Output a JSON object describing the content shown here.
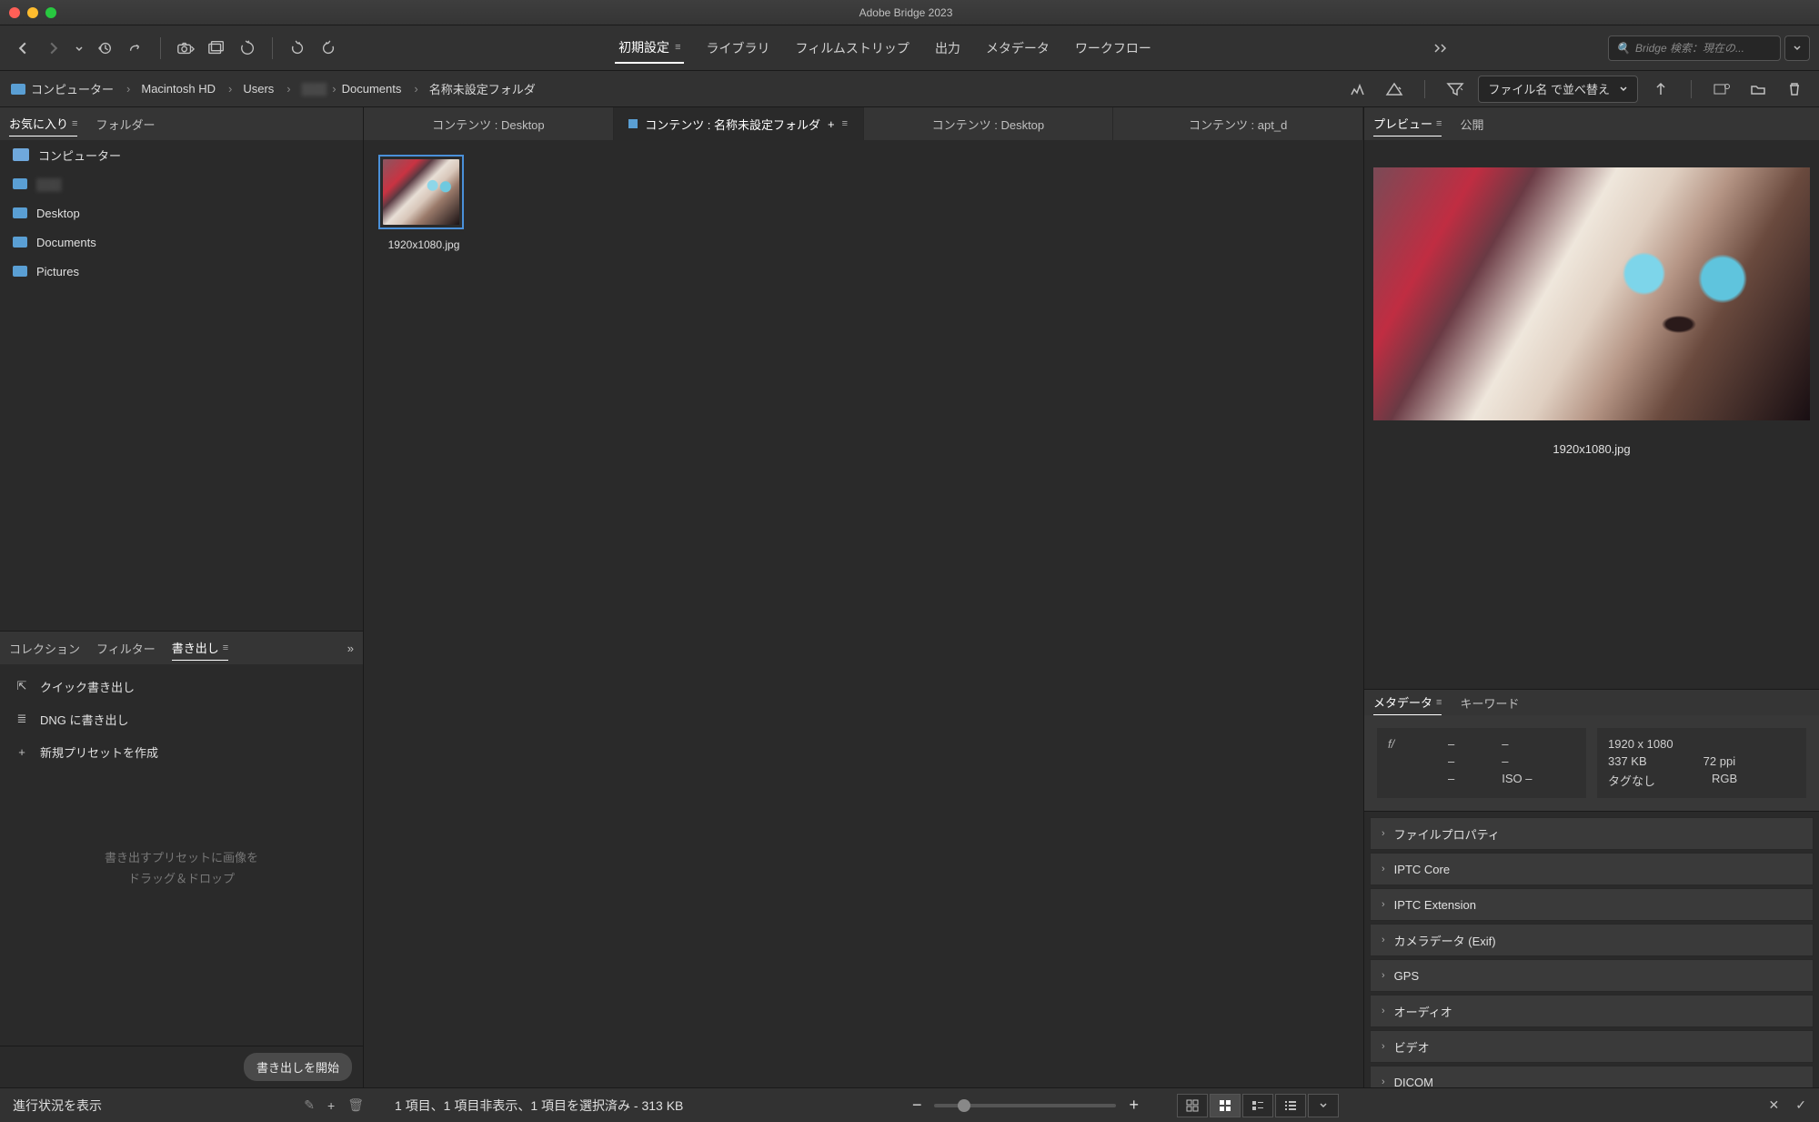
{
  "titlebar": {
    "title": "Adobe Bridge 2023"
  },
  "toolbar": {
    "workspaces": [
      "初期設定",
      "ライブラリ",
      "フィルムストリップ",
      "出力",
      "メタデータ",
      "ワークフロー"
    ],
    "active_workspace": 0,
    "search_placeholder": "Bridge 検索：現在の..."
  },
  "pathbar": {
    "crumbs": [
      "コンピューター",
      "Macintosh HD",
      "Users",
      "▒▒▒",
      "Documents",
      "名称未設定フォルダ"
    ],
    "sort_label": "ファイル名 で並べ替え"
  },
  "left": {
    "fav_tabs": [
      "お気に入り",
      "フォルダー"
    ],
    "fav_items": [
      "コンピューター",
      "▒▒▒",
      "Desktop",
      "Documents",
      "Pictures"
    ],
    "export_tabs": [
      "コレクション",
      "フィルター",
      "書き出し"
    ],
    "export_items": [
      "クイック書き出し",
      "DNG に書き出し",
      "新規プリセットを作成"
    ],
    "drop_hint_1": "書き出すプリセットに画像を",
    "drop_hint_2": "ドラッグ＆ドロップ",
    "export_start": "書き出しを開始",
    "progress_label": "進行状況を表示"
  },
  "center": {
    "tabs": [
      "コンテンツ : Desktop",
      "コンテンツ : 名称未設定フォルダ",
      "コンテンツ : Desktop",
      "コンテンツ : apt_d"
    ],
    "active_tab": 1,
    "tab_plus": "+",
    "thumb_name": "1920x1080.jpg",
    "status": "1 項目、1 項目非表示、1 項目を選択済み - 313 KB"
  },
  "right": {
    "preview_tabs": [
      "プレビュー",
      "公開"
    ],
    "preview_name": "1920x1080.jpg",
    "meta_tabs": [
      "メタデータ",
      "キーワード"
    ],
    "summary_left": [
      {
        "l": "f/",
        "v": "–",
        "v2": "–"
      },
      {
        "l": "",
        "v": "–",
        "v2": "–"
      },
      {
        "l": "",
        "v": "–",
        "v2": "ISO –"
      }
    ],
    "summary_right": [
      {
        "a": "1920 x 1080",
        "b": ""
      },
      {
        "a": "337 KB",
        "b": "72 ppi"
      },
      {
        "a": "タグなし",
        "b": "RGB"
      }
    ],
    "sections": [
      "ファイルプロパティ",
      "IPTC Core",
      "IPTC Extension",
      "カメラデータ (Exif)",
      "GPS",
      "オーディオ",
      "ビデオ",
      "DICOM"
    ]
  }
}
